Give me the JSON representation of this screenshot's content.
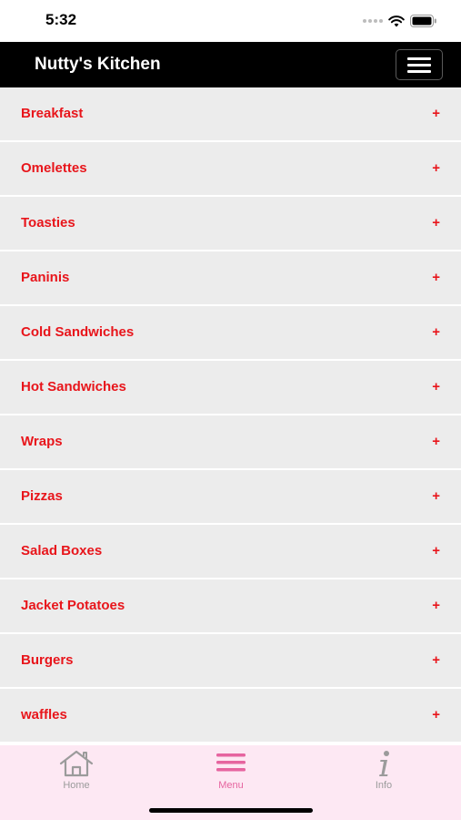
{
  "status_bar": {
    "time": "5:32"
  },
  "header": {
    "title": "Nutty's Kitchen"
  },
  "menu": {
    "items": [
      {
        "label": "Breakfast"
      },
      {
        "label": "Omelettes"
      },
      {
        "label": "Toasties"
      },
      {
        "label": "Paninis"
      },
      {
        "label": "Cold Sandwiches"
      },
      {
        "label": "Hot Sandwiches"
      },
      {
        "label": "Wraps"
      },
      {
        "label": "Pizzas"
      },
      {
        "label": "Salad Boxes"
      },
      {
        "label": "Jacket Potatoes"
      },
      {
        "label": "Burgers"
      },
      {
        "label": "waffles"
      }
    ],
    "expand_symbol": "+"
  },
  "tab_bar": {
    "home_label": "Home",
    "menu_label": "Menu",
    "info_label": "Info",
    "active_tab": "Menu"
  },
  "colors": {
    "header_bg": "#000000",
    "item_text": "#e8151b",
    "item_bg": "#ececec",
    "tab_bar_bg": "#fde8f3",
    "active_tab": "#e6649f",
    "inactive_tab": "#9b9b9b"
  },
  "icons": {
    "signal": "signal-dots-icon",
    "wifi": "wifi-icon",
    "battery": "battery-icon",
    "hamburger": "hamburger-icon",
    "home": "home-icon",
    "menu": "menu-lines-icon",
    "info": "info-icon"
  }
}
